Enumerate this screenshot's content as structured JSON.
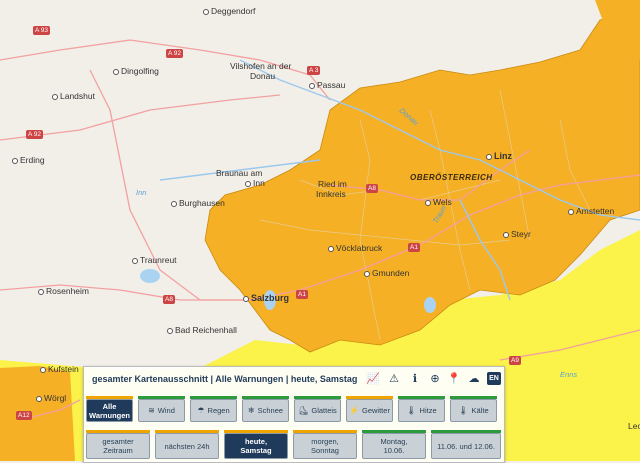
{
  "map": {
    "region_label": "OBERÖSTERREICH",
    "places": [
      {
        "id": "deggendorf",
        "name": "Deggendorf"
      },
      {
        "id": "dingolfing",
        "name": "Dingolfing"
      },
      {
        "id": "vilshofen",
        "name": "Vilshofen an der"
      },
      {
        "id": "donau",
        "name": "Donau"
      },
      {
        "id": "passau",
        "name": "Passau"
      },
      {
        "id": "landshut",
        "name": "Landshut"
      },
      {
        "id": "erding",
        "name": "Erding"
      },
      {
        "id": "braunau",
        "name": "Braunau am"
      },
      {
        "id": "inn",
        "name": "Inn"
      },
      {
        "id": "burghausen",
        "name": "Burghausen"
      },
      {
        "id": "ried",
        "name": "Ried im"
      },
      {
        "id": "innkreis",
        "name": "Innkreis"
      },
      {
        "id": "linz",
        "name": "Linz"
      },
      {
        "id": "wels",
        "name": "Wels"
      },
      {
        "id": "amstetten",
        "name": "Amstetten"
      },
      {
        "id": "steyr",
        "name": "Steyr"
      },
      {
        "id": "voecklabruck",
        "name": "Vöcklabruck"
      },
      {
        "id": "gmunden",
        "name": "Gmunden"
      },
      {
        "id": "traunreut",
        "name": "Traunreut"
      },
      {
        "id": "rosenheim",
        "name": "Rosenheim"
      },
      {
        "id": "salzburg",
        "name": "Salzburg"
      },
      {
        "id": "badreichenhall",
        "name": "Bad Reichenhall"
      },
      {
        "id": "kufstein",
        "name": "Kufstein"
      },
      {
        "id": "woergl",
        "name": "Wörgl"
      },
      {
        "id": "leo",
        "name": "Leo"
      }
    ],
    "roads": [
      "A 93",
      "A 92",
      "A 3",
      "A 92",
      "A8",
      "A1",
      "A1",
      "A8",
      "A9",
      "A12"
    ],
    "rivers": [
      "Inn",
      "Donau",
      "Enns",
      "Traun"
    ],
    "colors": {
      "warning_orange": "#f5b025",
      "warning_yellow": "#fbf24a",
      "land": "#f2efe9",
      "border": "#a06a00"
    }
  },
  "panel": {
    "title": "gesamter Kartenausschnitt | Alle Warnungen | heute, Samstag",
    "tools": [
      {
        "id": "chart",
        "icon": "chart-icon",
        "glyph": "📈"
      },
      {
        "id": "warning",
        "icon": "warning-icon",
        "glyph": "⚠"
      },
      {
        "id": "info",
        "icon": "info-icon",
        "glyph": "ℹ"
      },
      {
        "id": "zoom",
        "icon": "zoom-icon",
        "glyph": "⊕"
      },
      {
        "id": "location",
        "icon": "location-icon",
        "glyph": "📍"
      },
      {
        "id": "cloud",
        "icon": "cloud-icon",
        "glyph": "☁"
      }
    ],
    "lang": "EN",
    "categories": [
      {
        "label_line1": "Alle",
        "label_line2": "Warnungen",
        "icon": "",
        "active": true
      },
      {
        "label": "Wind",
        "icon": "≋"
      },
      {
        "label": "Regen",
        "icon": "☂"
      },
      {
        "label": "Schnee",
        "icon": "❄"
      },
      {
        "label": "Glatteis",
        "icon": "⛸"
      },
      {
        "label": "Gewitter",
        "icon": "⚡"
      },
      {
        "label": "Hitze",
        "icon": "🌡"
      },
      {
        "label": "Kälte",
        "icon": "🌡"
      }
    ],
    "periods": [
      {
        "line1": "gesamter",
        "line2": "Zeitraum",
        "active": false
      },
      {
        "line1": "nächsten 24h",
        "line2": "",
        "active": false
      },
      {
        "line1": "heute,",
        "line2": "Samstag",
        "active": true
      },
      {
        "line1": "morgen,",
        "line2": "Sonntag",
        "active": false
      },
      {
        "line1": "Montag,",
        "line2": "10.06.",
        "active": false
      },
      {
        "line1": "11.06. und 12.06.",
        "line2": "",
        "active": false
      }
    ]
  }
}
